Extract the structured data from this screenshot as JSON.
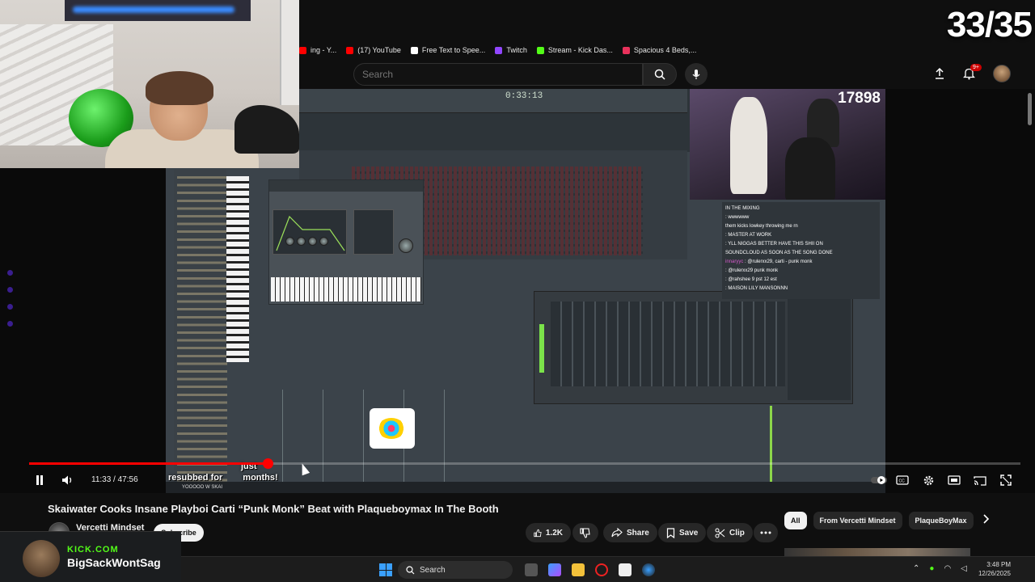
{
  "overlay": {
    "counter": "33/35"
  },
  "bookmarks": [
    {
      "label": "ing - Y...",
      "icon": "youtube-icon",
      "color": "#ff0000"
    },
    {
      "label": "(17) YouTube",
      "icon": "youtube-icon",
      "color": "#ff0000"
    },
    {
      "label": "Free Text to Spee...",
      "icon": "text-icon",
      "color": "#ffffff"
    },
    {
      "label": "Twitch",
      "icon": "twitch-icon",
      "color": "#9146ff"
    },
    {
      "label": "Stream - Kick Das...",
      "icon": "kick-icon",
      "color": "#53fc18"
    },
    {
      "label": "Spacious 4 Beds,...",
      "icon": "home-icon",
      "color": "#e8315b"
    }
  ],
  "search": {
    "placeholder": "Search"
  },
  "notifications": {
    "badge": "9+"
  },
  "stream": {
    "viewer_count": "17898",
    "chat": [
      {
        "user": "",
        "text": "IN THE MIXING"
      },
      {
        "user": "",
        "text": ": wwwwww"
      },
      {
        "user": "",
        "text": "them kicks lowkey throwing me rn"
      },
      {
        "user": "",
        "text": ": MASTER AT WORK"
      },
      {
        "user": "",
        "text": ": YLL NIGGAS BETTER HAVE THIS SHII ON"
      },
      {
        "user": "",
        "text": "SOUNDCLOUD AS SOON AS THE SONG DONE"
      },
      {
        "user": "innaryyc",
        "text": ": @rulerxx29, carti - punk monk"
      },
      {
        "user": "",
        "text": ": @rulerxx29 punk monk"
      },
      {
        "user": "",
        "text": ": @rahshee 9 pst 12 est"
      },
      {
        "user": "",
        "text": ": MAISON LILY MANSONNN"
      }
    ],
    "sub_alert_line1": "just",
    "sub_alert_line2": "resubbed for",
    "sub_alert_line3": "months!",
    "sub_alert_sub": "YOOOOO W SKAI",
    "daw_time": "0:33:13"
  },
  "player": {
    "current_time": "11:33",
    "duration": "47:56",
    "time_display": "11:33 / 47:56",
    "progress_fraction": 0.241
  },
  "video": {
    "title": "Skaiwater Cooks Insane Playboi Carti “Punk Monk” Beat with Plaqueboymax In The Booth",
    "channel": "Vercetti Mindset",
    "subscribe_label": "Subscribe",
    "likes": "1.2K",
    "share_label": "Share",
    "save_label": "Save",
    "clip_label": "Clip"
  },
  "chips": [
    {
      "label": "All",
      "active": true
    },
    {
      "label": "From Vercetti Mindset",
      "active": false
    },
    {
      "label": "PlaqueBoyMax",
      "active": false
    }
  ],
  "kick": {
    "site": "KICK.COM",
    "username": "BigSackWontSag"
  },
  "taskbar": {
    "search_label": "Search",
    "time": "3:48 PM",
    "date": "12/26/2025"
  }
}
